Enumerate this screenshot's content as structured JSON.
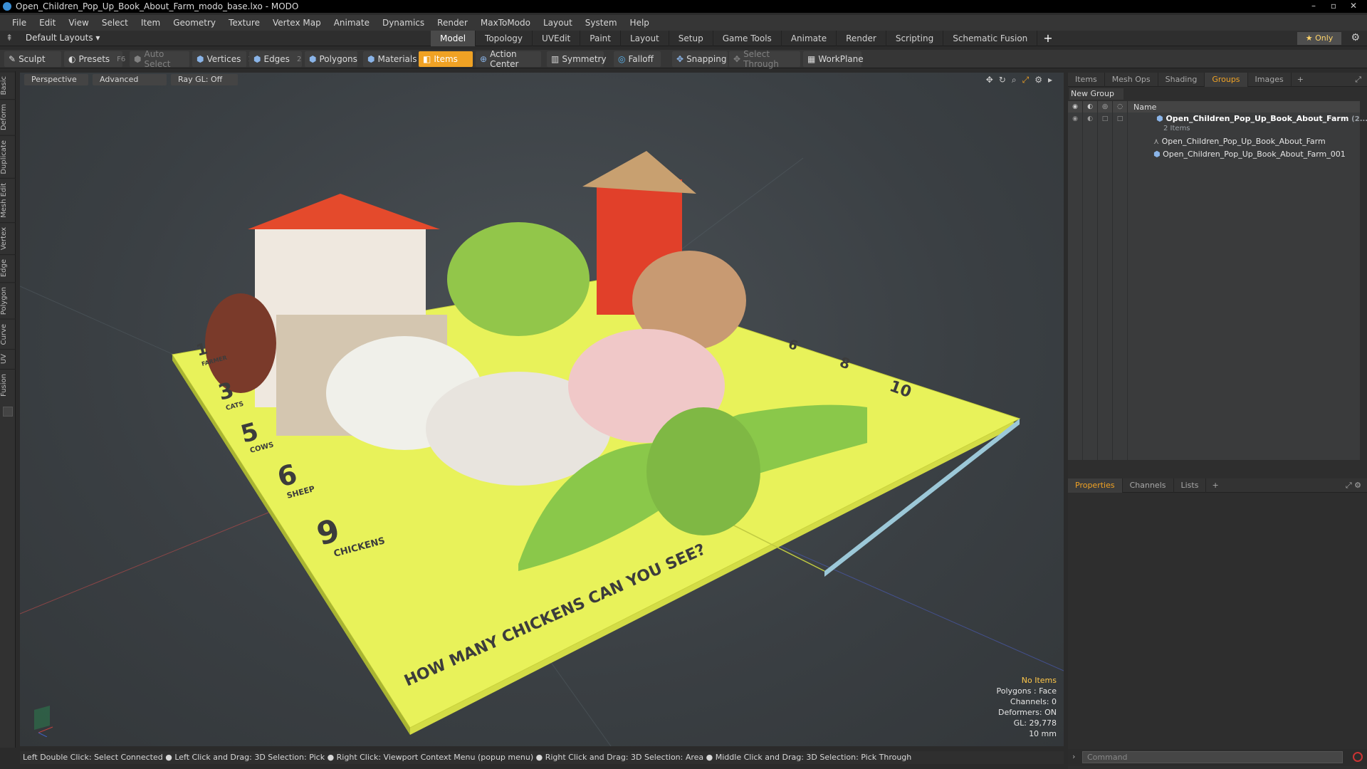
{
  "window": {
    "title": "Open_Children_Pop_Up_Book_About_Farm_modo_base.lxo - MODO",
    "controls": [
      "minimize",
      "maximize",
      "close"
    ]
  },
  "menu": [
    "File",
    "Edit",
    "View",
    "Select",
    "Item",
    "Geometry",
    "Texture",
    "Vertex Map",
    "Animate",
    "Dynamics",
    "Render",
    "MaxToModo",
    "Layout",
    "System",
    "Help"
  ],
  "layouts": {
    "label": "Default Layouts ▾"
  },
  "tabs": {
    "items": [
      "Model",
      "Topology",
      "UVEdit",
      "Paint",
      "Layout",
      "Setup",
      "Game Tools",
      "Animate",
      "Render",
      "Scripting",
      "Schematic Fusion"
    ],
    "active": "Model",
    "only_label": "Only"
  },
  "toolbar": {
    "sculpt": "Sculpt",
    "presets": "Presets",
    "presets_hotkey": "F6",
    "auto_select": "Auto Select",
    "vertices": "Vertices",
    "vertices_hotkey": "1",
    "edges": "Edges",
    "edges_hotkey": "2",
    "polygons": "Polygons",
    "materials": "Materials",
    "items": "Items",
    "action_center": "Action Center",
    "symmetry": "Symmetry",
    "falloff": "Falloff",
    "snapping": "Snapping",
    "select_through": "Select Through",
    "workplane": "WorkPlane"
  },
  "left_tabs": [
    "Basic",
    "Deform",
    "Duplicate",
    "Mesh Edit",
    "Vertex",
    "Edge",
    "Polygon",
    "Curve",
    "UV",
    "Fusion"
  ],
  "viewport": {
    "view": "Perspective",
    "shading": "Advanced",
    "raygl": "Ray GL: Off",
    "scene_text": {
      "question": "HOW MANY CHICKENS CAN YOU SEE?",
      "counts": [
        {
          "n": "1",
          "w": "FARMER"
        },
        {
          "n": "3",
          "w": "CATS"
        },
        {
          "n": "5",
          "w": "COWS"
        },
        {
          "n": "6",
          "w": "SHEEP"
        },
        {
          "n": "9",
          "w": "CHICKENS"
        }
      ],
      "back_counts": [
        "6",
        "8",
        "10"
      ]
    },
    "info": {
      "no_items": "No Items",
      "polygons": "Polygons : Face",
      "channels": "Channels: 0",
      "deformers": "Deformers: ON",
      "gl": "GL: 29,778",
      "scale": "10 mm"
    }
  },
  "status_bar": "Left Double Click: Select Connected ● Left Click and Drag: 3D Selection: Pick ● Right Click: Viewport Context Menu (popup menu) ● Right Click and Drag: 3D Selection: Area ● Middle Click and Drag: 3D Selection: Pick Through",
  "right_panel": {
    "tabs": [
      "Items",
      "Mesh Ops",
      "Shading",
      "Groups",
      "Images"
    ],
    "active_tab": "Groups",
    "new_group": "New Group",
    "name_header": "Name",
    "group": {
      "name": "Open_Children_Pop_Up_Book_About_Farm",
      "suffix": "(2...",
      "count": "2 Items",
      "children": [
        "Open_Children_Pop_Up_Book_About_Farm",
        "Open_Children_Pop_Up_Book_About_Farm_001"
      ]
    },
    "lower_tabs": [
      "Properties",
      "Channels",
      "Lists"
    ],
    "lower_active": "Properties",
    "command_placeholder": "Command"
  },
  "colors": {
    "accent": "#f0a224",
    "book_yellow": "#e8f25a",
    "info_warn": "#ffc84a"
  }
}
